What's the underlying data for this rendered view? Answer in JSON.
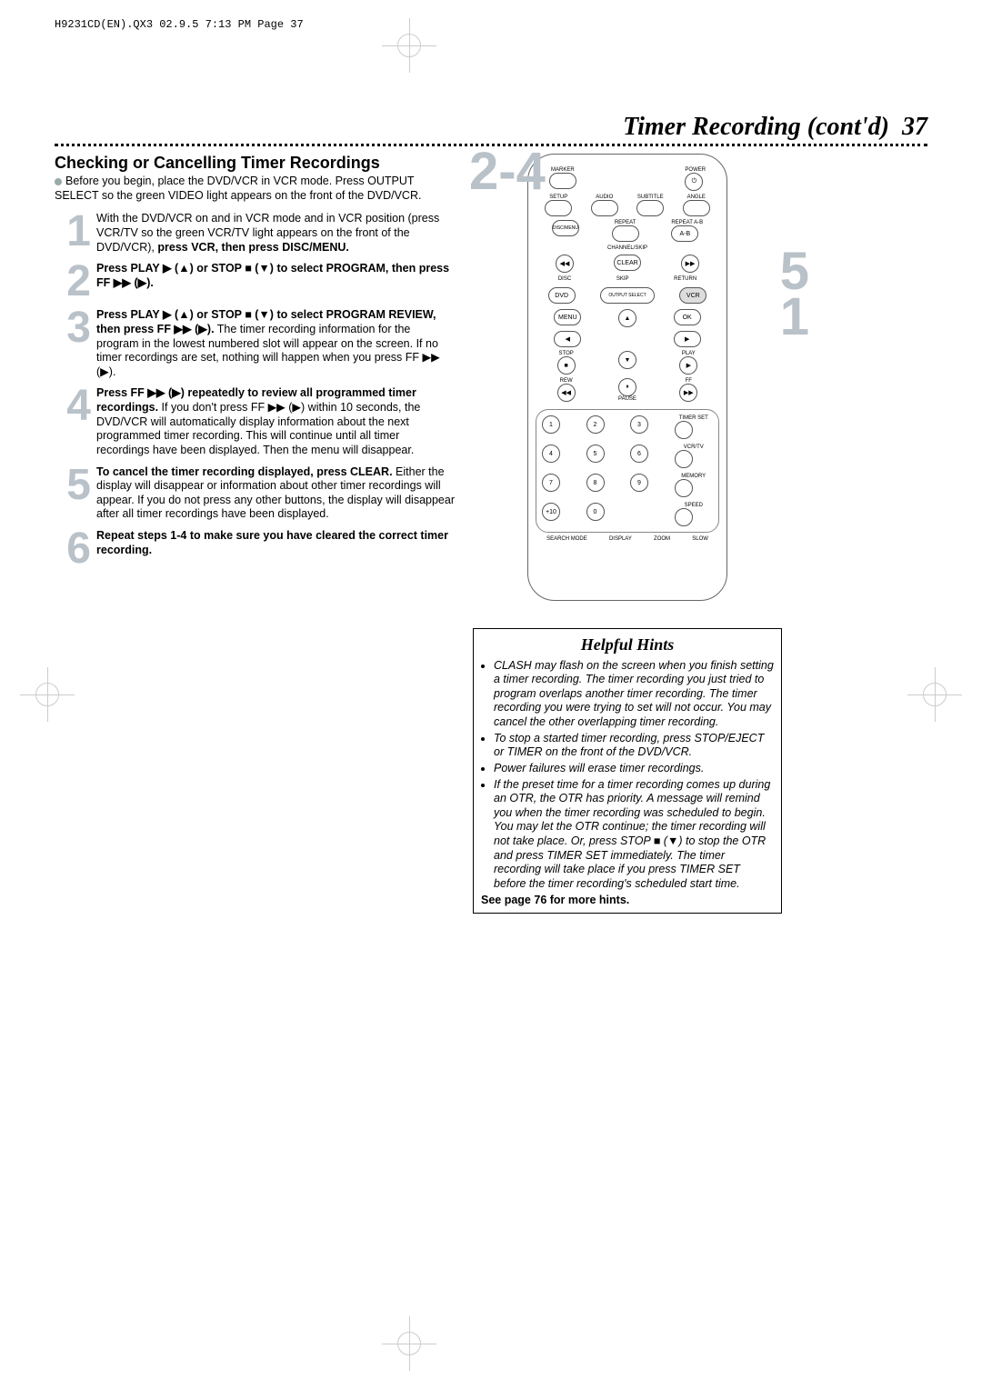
{
  "slugline": "H9231CD(EN).QX3  02.9.5 7:13 PM  Page 37",
  "chapter": {
    "title": "Timer Recording (cont'd)",
    "page": "37"
  },
  "section": {
    "title": "Checking or Cancelling Timer Recordings",
    "intro": "Before you begin, place the DVD/VCR in VCR mode. Press OUTPUT SELECT so the green VIDEO light appears on the front of the DVD/VCR."
  },
  "steps": [
    {
      "n": "1",
      "html": "With the DVD/VCR on and in VCR mode and in VCR position (press VCR/TV so the green VCR/TV light appears on the front of the DVD/VCR), <b>press VCR, then press DISC/MENU.</b>"
    },
    {
      "n": "2",
      "html": "<b>Press PLAY ▶ (▲) or STOP ■ (▼) to select PROGRAM, then press FF ▶▶ (▶).</b>"
    },
    {
      "n": "3",
      "html": "<b>Press PLAY ▶ (▲) or STOP ■ (▼) to select PROGRAM REVIEW, then press FF ▶▶ (▶).</b> The timer recording information for the program in the lowest numbered slot will appear on the screen. If no timer recordings are set, nothing will happen when you press FF ▶▶ (▶)."
    },
    {
      "n": "4",
      "html": "<b>Press FF ▶▶ (▶) repeatedly to review all programmed timer recordings.</b> If you don't press FF ▶▶ (▶) within 10 seconds, the DVD/VCR will automatically display information about the next programmed timer recording. This will continue until all timer recordings have been displayed. Then the menu will disappear."
    },
    {
      "n": "5",
      "html": "<b>To cancel the timer recording displayed, press CLEAR.</b> Either the display will disappear or information about other timer recordings will appear. If you do not press any other buttons, the display will disappear after all timer recordings have been displayed."
    },
    {
      "n": "6",
      "html": "<b>Repeat steps 1-4 to make sure you have cleared the correct timer recording.</b>"
    }
  ],
  "callouts": {
    "top": "2-4",
    "mid": "5",
    "low": "1"
  },
  "hints": {
    "title": "Helpful Hints",
    "items": [
      "CLASH may flash on the screen when you finish setting a timer recording. The timer recording you just tried to program overlaps another timer recording. The timer recording you were trying to set will not occur. You may cancel the other overlapping timer recording.",
      "To stop a started timer recording, press STOP/EJECT or TIMER on the front of the DVD/VCR.",
      "Power failures will erase timer recordings.",
      "If the preset time for a timer recording comes up during an OTR, the OTR has priority. A message will remind you when the timer recording was scheduled to begin. You may let the OTR continue; the timer recording will not take place. Or, press STOP ■ (▼) to stop the OTR and press TIMER SET immediately. The timer recording will take place if you press TIMER SET before the timer recording's scheduled start time."
    ],
    "footer": "See page 76 for more hints."
  },
  "remote": {
    "row1": [
      "MARKER",
      "POWER"
    ],
    "row2": [
      "SETUP",
      "AUDIO",
      "SUBTITLE",
      "ANGLE"
    ],
    "row3": [
      "DISC/MENU",
      "REPEAT",
      "REPEAT A-B"
    ],
    "row4": [
      "◀◀",
      "CLEAR",
      "▶▶"
    ],
    "row4b": [
      "DISC",
      "SKIP",
      "RETURN"
    ],
    "row5": [
      "DVD",
      "OUTPUT SELECT",
      "VCR"
    ],
    "row6": [
      "MENU",
      "▲",
      "OK"
    ],
    "row7": [
      "◀",
      "▶"
    ],
    "row8a": [
      "STOP",
      "▼",
      "PLAY"
    ],
    "row8": [
      "■",
      "",
      "▶"
    ],
    "row9a": [
      "REW",
      "⏸",
      "FF"
    ],
    "row9": [
      "◀◀",
      "PAUSE",
      "▶▶"
    ],
    "numpad": [
      "1",
      "2",
      "3",
      "TIMER SET",
      "4",
      "5",
      "6",
      "VCR/TV",
      "7",
      "8",
      "9",
      "MEMORY",
      "+10",
      "0",
      "",
      "SPEED"
    ],
    "bottom": [
      "SEARCH MODE",
      "DISPLAY",
      "ZOOM",
      "SLOW"
    ]
  }
}
